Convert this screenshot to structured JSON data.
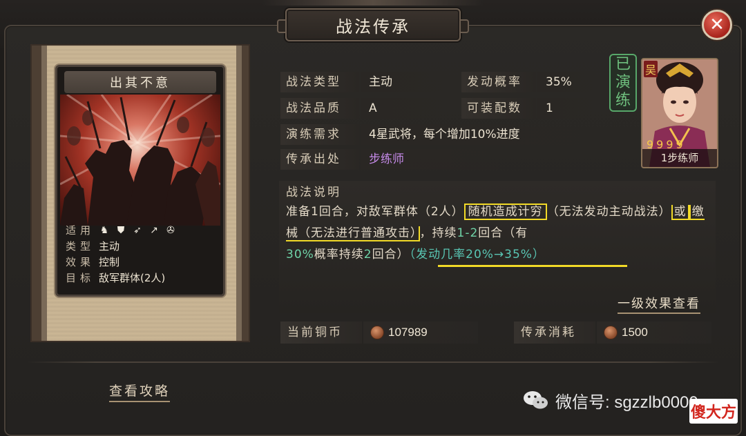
{
  "title": "战法传承",
  "close_icon": "close-icon",
  "skill_card": {
    "name": "出其不意",
    "props": [
      {
        "key": "适用",
        "value": ""
      },
      {
        "key": "类型",
        "value": "主动"
      },
      {
        "key": "效果",
        "value": "控制"
      },
      {
        "key": "目标",
        "value": "敌军群体(2人)"
      }
    ],
    "applicable_icons": [
      "cavalry-icon",
      "shield-icon",
      "bow-icon",
      "spear-icon",
      "wheel-icon"
    ]
  },
  "info": {
    "type_label": "战法类型",
    "type_value": "主动",
    "rate_label": "发动概率",
    "rate_value": "35%",
    "quality_label": "战法品质",
    "quality_value": "A",
    "equip_label": "可装配数",
    "equip_value": "1",
    "req_label": "演练需求",
    "req_value": "4星武将，每个增加10%进度",
    "source_label": "传承出处",
    "source_value": "步练师"
  },
  "hero": {
    "stamp": [
      "已",
      "演",
      "练"
    ],
    "faction": "吴",
    "stars": "9999",
    "label": "1步练师"
  },
  "description": {
    "title": "战法说明",
    "part1": "准备1回合，对敌军群体（2人）",
    "part2": "随机造成计穷",
    "part3": "（无法发动主动战法）",
    "part4": "或",
    "part5": "缴械（无法进行普通攻击）",
    "part6": "，持续",
    "part7": "1-2",
    "part8": "回合（有",
    "part9": "30%",
    "part10": "概率持续",
    "part11": "2",
    "part12": "回合）",
    "part13": "（发动几率20%→35%）",
    "effect_link": "一级效果查看"
  },
  "money": {
    "current_label": "当前铜币",
    "current_value": "107989",
    "cost_label": "传承消耗",
    "cost_value": "1500"
  },
  "guide_link": "查看攻略",
  "watermark": {
    "text": "微信号: sgzzlb0000",
    "badge": "傻大方"
  },
  "colors": {
    "accent_yellow": "#f2da27",
    "teal": "#6fd3a7",
    "purple": "#c58ae8",
    "close_red": "#c0392b"
  }
}
